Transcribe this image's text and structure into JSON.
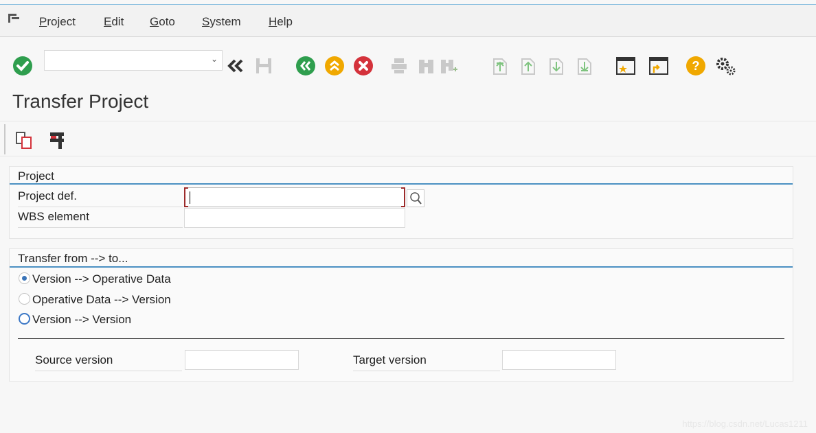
{
  "menu": {
    "items": [
      {
        "label": "Project",
        "key": "P"
      },
      {
        "label": "Edit",
        "key": "E"
      },
      {
        "label": "Goto",
        "key": "G"
      },
      {
        "label": "System",
        "key": "S"
      },
      {
        "label": "Help",
        "key": "H"
      }
    ]
  },
  "toolbar": {
    "command_field_value": "",
    "icons": [
      "enter-icon",
      "back-double-arrow-icon",
      "save-icon",
      "back-icon",
      "exit-icon",
      "cancel-icon",
      "print-icon",
      "find-icon",
      "find-next-icon",
      "first-page-icon",
      "previous-page-icon",
      "next-page-icon",
      "last-page-icon",
      "create-session-icon",
      "shortcut-icon",
      "help-icon",
      "customize-layout-icon"
    ]
  },
  "page": {
    "title": "Transfer Project"
  },
  "project_group": {
    "title": "Project",
    "project_def_label": "Project def.",
    "project_def_value": "",
    "wbs_label": "WBS element",
    "wbs_value": ""
  },
  "transfer_group": {
    "title": "Transfer  from --> to...",
    "options": [
      {
        "label": "Version --> Operative Data",
        "selected": true
      },
      {
        "label": "Operative Data --> Version",
        "selected": false
      },
      {
        "label": "Version --> Version",
        "selected": false
      }
    ],
    "source_label": "Source version",
    "source_value": "",
    "target_label": "Target version",
    "target_value": ""
  },
  "watermark": "https://blog.csdn.net/Lucas1211",
  "colors": {
    "accent": "#4a90c2",
    "enter_green": "#2f9e4e",
    "exit_orange": "#f0a800",
    "cancel_red": "#d4323b",
    "help_orange": "#f0a800"
  }
}
